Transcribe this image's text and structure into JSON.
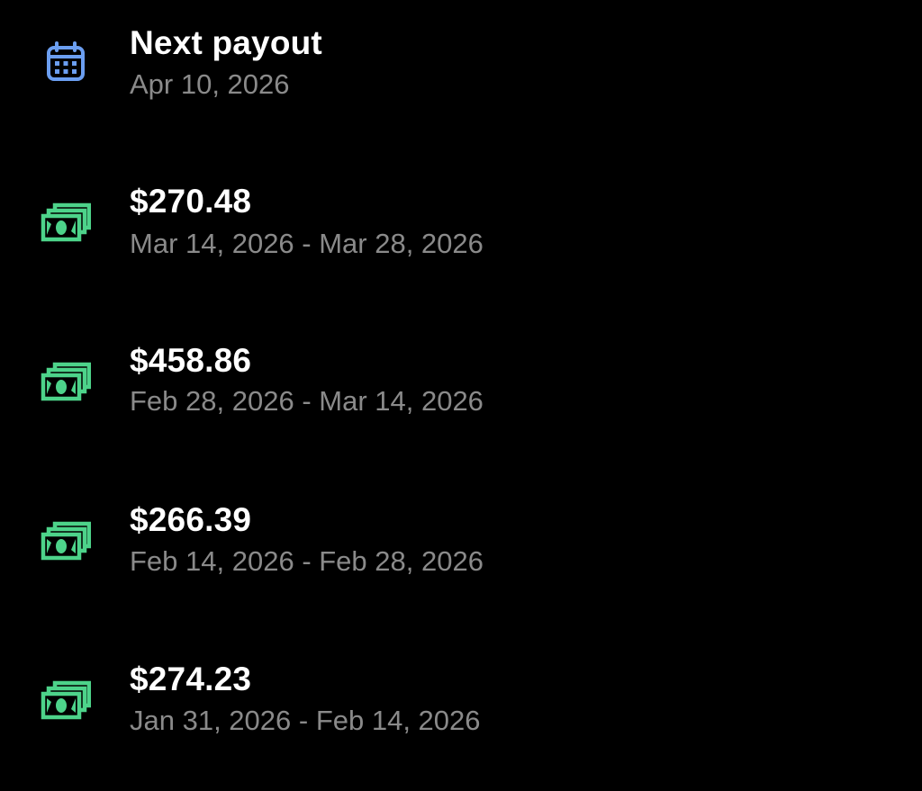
{
  "next_payout": {
    "title": "Next payout",
    "date": "Apr 10, 2026",
    "icon": "calendar-icon",
    "icon_color": "#6b9ef0"
  },
  "payouts": [
    {
      "amount": "$270.48",
      "period": "Mar 14, 2026 - Mar 28, 2026",
      "icon": "money-icon"
    },
    {
      "amount": "$458.86",
      "period": "Feb 28, 2026 - Mar 14, 2026",
      "icon": "money-icon"
    },
    {
      "amount": "$266.39",
      "period": "Feb 14, 2026 - Feb 28, 2026",
      "icon": "money-icon"
    },
    {
      "amount": "$274.23",
      "period": "Jan 31, 2026 - Feb 14, 2026",
      "icon": "money-icon"
    }
  ],
  "colors": {
    "background": "#000000",
    "title": "#ffffff",
    "subtitle": "#8a8a8a",
    "money_icon": "#4dd38a"
  }
}
